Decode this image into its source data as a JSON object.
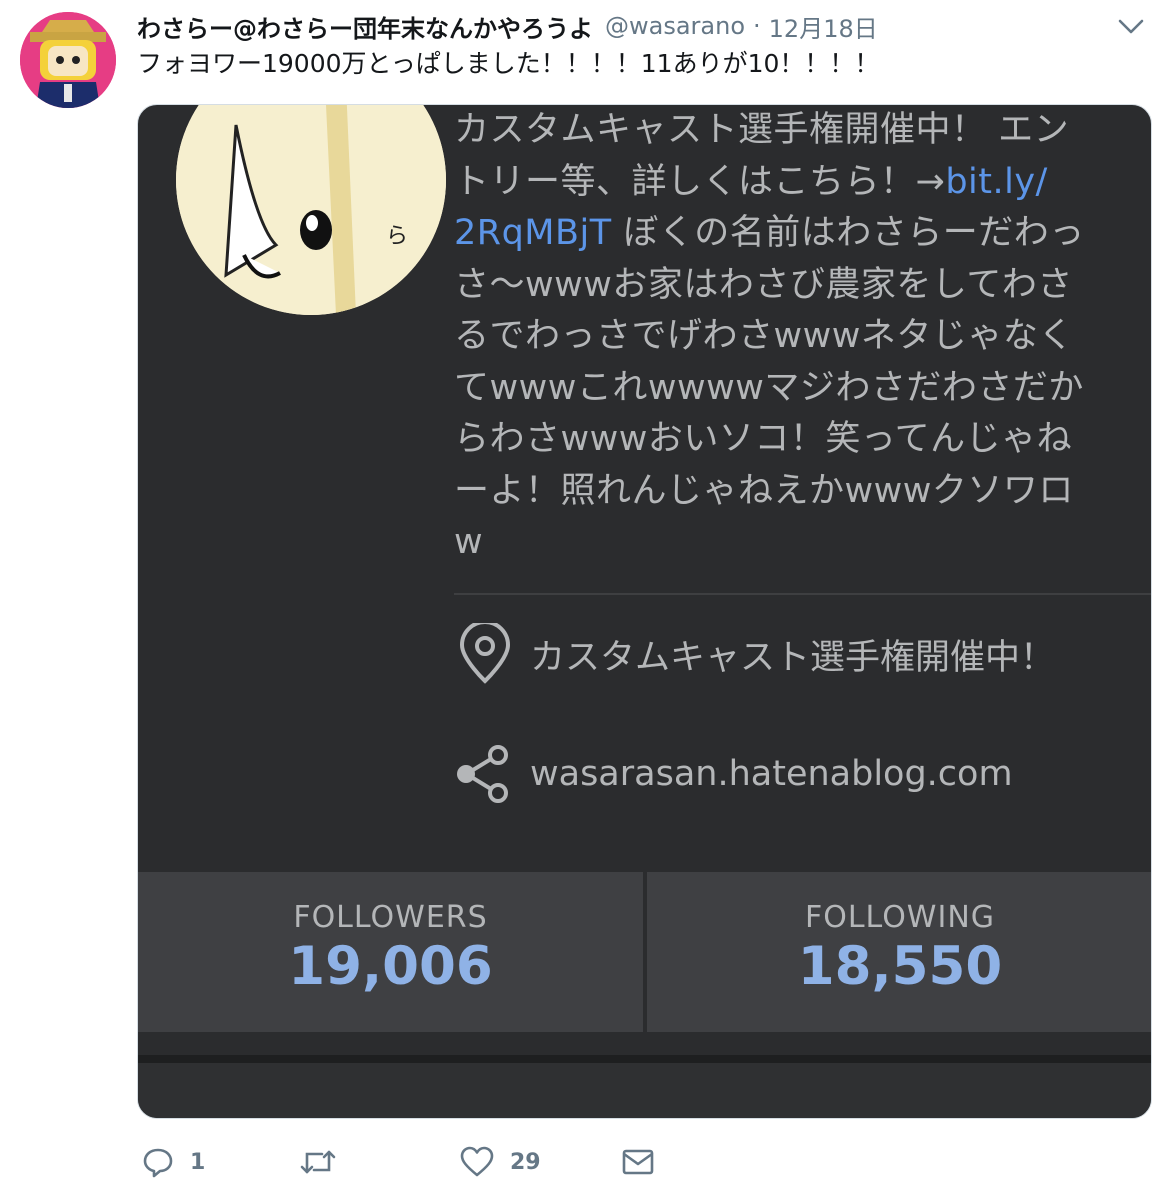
{
  "tweet": {
    "display_name": "わさらー@わさらー団年末なんかやろうよ",
    "handle": "@wasarano",
    "separator": "·",
    "date": "12月18日",
    "text": "フォヨワー19000万とっぱしました！！！！11ありが10！！！！"
  },
  "media": {
    "bio_lines": [
      "カスタムキャスト選手権開催中！ エン",
      "トリー等、詳しくはこちら！→",
      "ぼくの名前はわさらーだわっ",
      "さ〜wwwお家はわさび農家をしてわさ",
      "るでわっさでげわさwwwネタじゃなく",
      "てwwwこれwwwwマジわさだわさだか",
      "らわさwwwおいソコ！笑ってんじゃね",
      "ーよ！照れんじゃねえかwwwクソワロ",
      "w"
    ],
    "bio_link_1": "bit.ly/",
    "bio_link_2": "2RqMBjT",
    "location": "カスタムキャスト選手権開催中！",
    "website": "wasarasan.hatenablog.com",
    "followers_label": "FOLLOWERS",
    "followers_value": "19,006",
    "following_label": "FOLLOWING",
    "following_value": "18,550",
    "profile_badge_text": "ら"
  },
  "actions": {
    "reply_count": "1",
    "retweet_count": "",
    "like_count": "29"
  },
  "colors": {
    "link": "#5c95e8",
    "media_bg": "#2b2c2e",
    "stat_value": "#8fb2e6",
    "muted": "#657786"
  },
  "icons": {
    "caret": "chevron-down-icon",
    "location": "location-pin-icon",
    "website": "share-icon",
    "reply": "reply-icon",
    "retweet": "retweet-icon",
    "like": "heart-icon",
    "dm": "envelope-icon"
  }
}
